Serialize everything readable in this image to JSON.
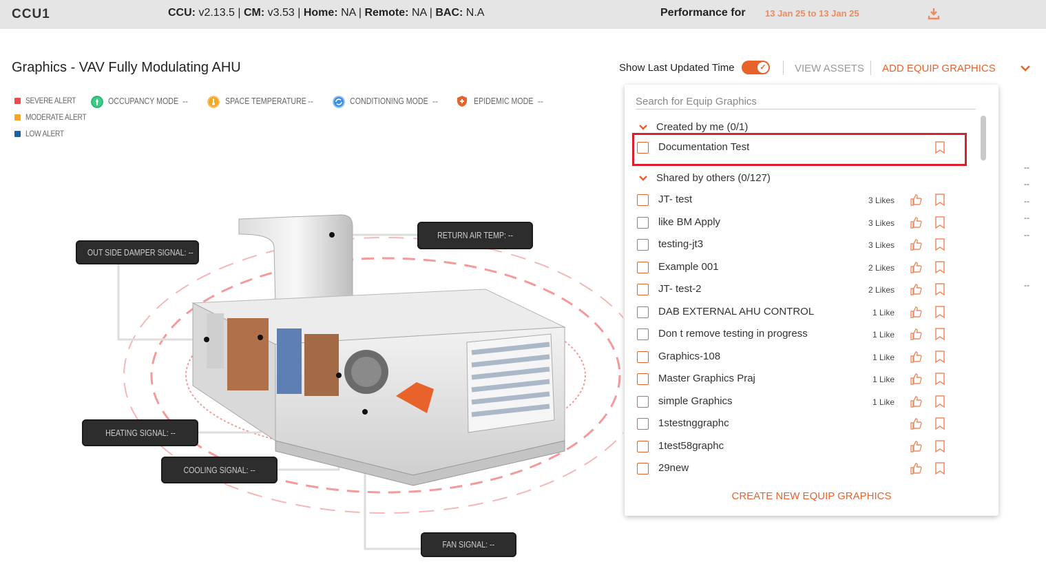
{
  "header": {
    "ccu_name": "CCU1",
    "ccu_label": "CCU:",
    "ccu_version": "v2.13.5",
    "cm_label": "CM:",
    "cm_version": "v3.53",
    "home_label": "Home:",
    "home_value": "NA",
    "remote_label": "Remote:",
    "remote_value": "NA",
    "bac_label": "BAC:",
    "bac_value": "N.A",
    "performance_label": "Performance for",
    "performance_range": "13 Jan 25 to 13 Jan 25",
    "download_icon": "download-icon"
  },
  "page": {
    "title": "Graphics - VAV Fully Modulating AHU",
    "show_last_updated_label": "Show Last Updated Time",
    "show_last_updated_on": true,
    "view_assets": "VIEW ASSETS",
    "add_equip_graphics": "ADD EQUIP GRAPHICS"
  },
  "alerts": {
    "severe": "SEVERE ALERT",
    "moderate": "MODERATE ALERT",
    "low": "LOW ALERT",
    "severe_color": "#e84c4c",
    "moderate_color": "#f5a623",
    "low_color": "#1f5fa8"
  },
  "modes": [
    {
      "label": "OCCUPANCY MODE",
      "value": "--",
      "color": "#2bb673",
      "icon": "occupancy-icon"
    },
    {
      "label": "SPACE TEMPERATURE",
      "value": "--",
      "color": "#f5a623",
      "icon": "thermometer-icon"
    },
    {
      "label": "CONDITIONING MODE",
      "value": "--",
      "color": "#3b8fe0",
      "icon": "conditioning-icon"
    },
    {
      "label": "EPIDEMIC MODE",
      "value": "--",
      "color": "#e8632b",
      "icon": "shield-icon"
    }
  ],
  "callouts": {
    "outside_damper": "OUT SIDE DAMPER SIGNAL: --",
    "return_air": "RETURN AIR TEMP: --",
    "heating": "HEATING SIGNAL: --",
    "cooling": "COOLING SIGNAL: --",
    "fan": "FAN SIGNAL: --"
  },
  "right_values": [
    "--",
    "--",
    "--",
    "--",
    "--",
    "--"
  ],
  "dropdown": {
    "search_placeholder": "Search for Equip Graphics",
    "created_by_me": "Created by me (0/1)",
    "created_items": [
      {
        "name": "Documentation Test"
      }
    ],
    "shared_by_others": "Shared by others (0/127)",
    "shared_items": [
      {
        "name": "JT- test",
        "likes": "3 Likes"
      },
      {
        "name": "like BM Apply",
        "likes": "3 Likes"
      },
      {
        "name": "testing-jt3",
        "likes": "3 Likes"
      },
      {
        "name": "Example 001",
        "likes": "2 Likes"
      },
      {
        "name": "JT- test-2",
        "likes": "2 Likes"
      },
      {
        "name": "DAB EXTERNAL AHU CONTROL",
        "likes": "1 Like"
      },
      {
        "name": "Don t remove testing in progress",
        "likes": "1 Like"
      },
      {
        "name": "Graphics-108",
        "likes": "1 Like"
      },
      {
        "name": "Master Graphics Praj",
        "likes": "1 Like"
      },
      {
        "name": "simple Graphics",
        "likes": "1 Like"
      },
      {
        "name": "1stestnggraphc",
        "likes": ""
      },
      {
        "name": "1test58graphc",
        "likes": ""
      },
      {
        "name": "29new",
        "likes": ""
      }
    ],
    "create_new": "CREATE NEW EQUIP GRAPHICS"
  },
  "colors": {
    "accent": "#e8632b",
    "highlight": "#d9202a"
  }
}
